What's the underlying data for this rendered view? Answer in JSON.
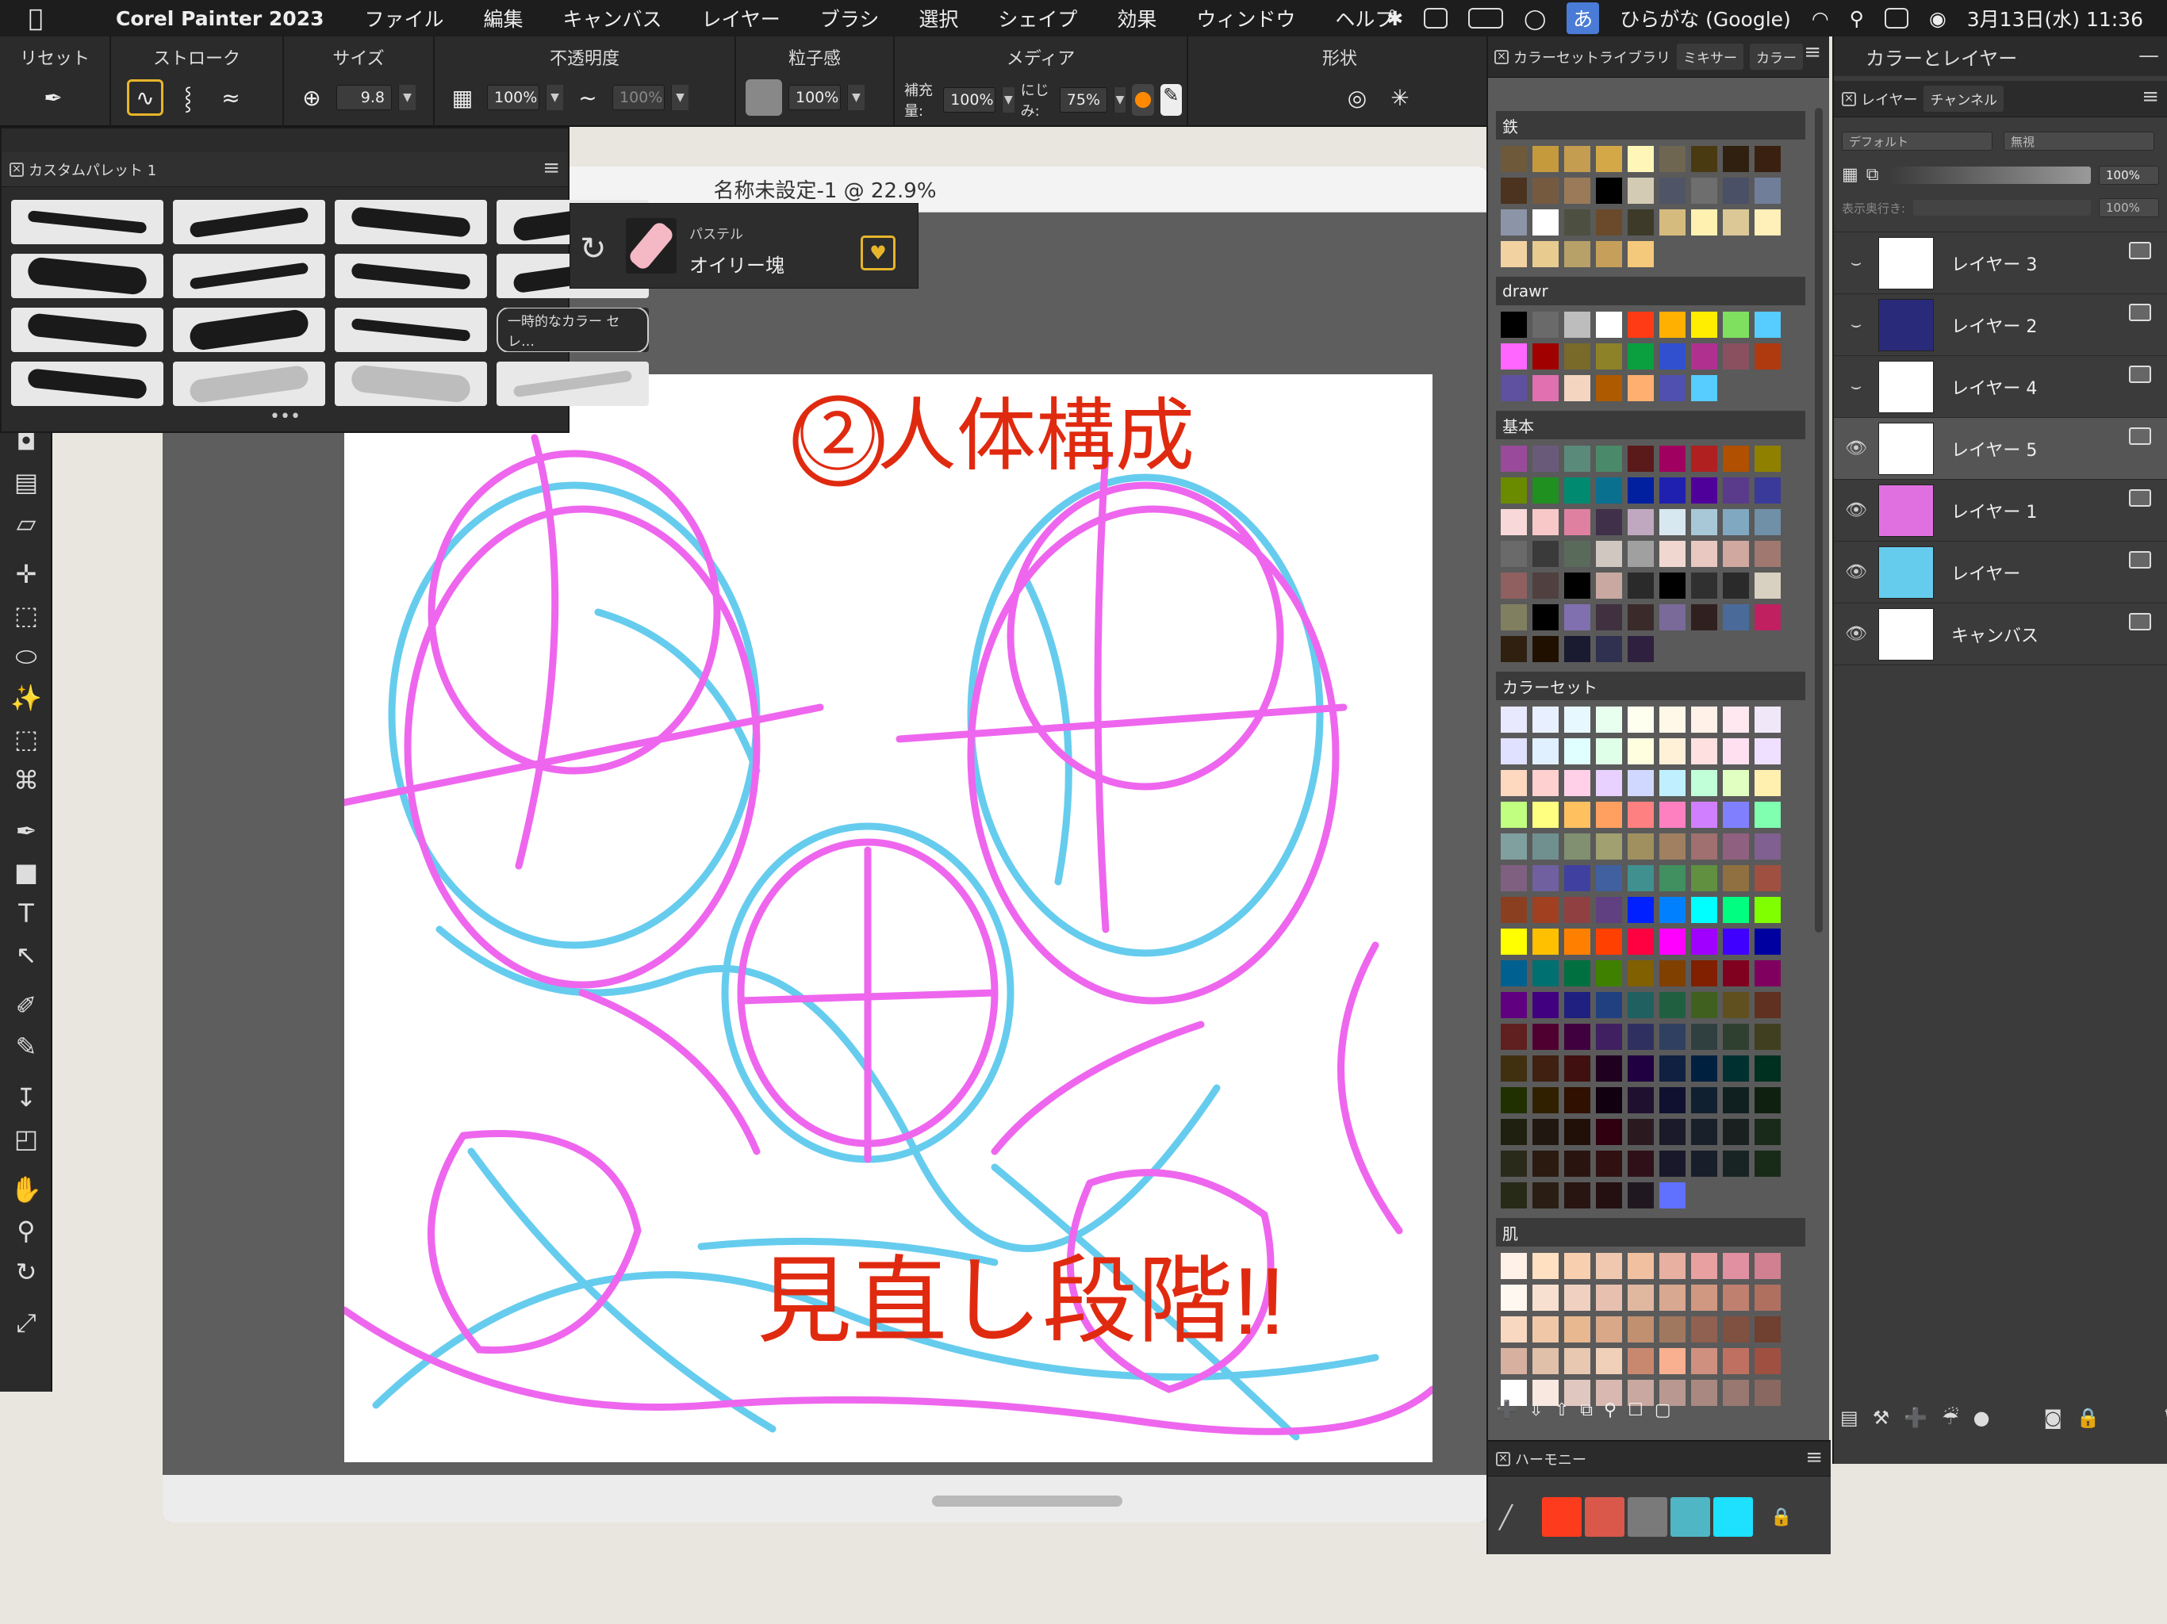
{
  "menubar": {
    "app_name": "Corel Painter 2023",
    "items": [
      "ファイル",
      "編集",
      "キャンバス",
      "レイヤー",
      "ブラシ",
      "選択",
      "シェイプ",
      "効果",
      "ウィンドウ",
      "ヘルプ"
    ],
    "input_method": "ひらがな (Google)",
    "ime_glyph": "あ",
    "datetime": "3月13日(水)  11:36"
  },
  "propbar": {
    "groups": [
      {
        "title": "リセット"
      },
      {
        "title": "ストローク"
      },
      {
        "title": "サイズ"
      },
      {
        "title": "不透明度"
      },
      {
        "title": "粒子感"
      },
      {
        "title": "メディア"
      },
      {
        "title": "形状"
      }
    ],
    "size_value": "9.8",
    "opacity_value": "100%",
    "opacity_value2": "100%",
    "grain_value": "100%",
    "media": {
      "resaturation_label": "補充量:",
      "resaturation_value": "100%",
      "bleed_label": "にじみ:",
      "bleed_value": "75%"
    }
  },
  "document": {
    "title": "名称未設定-1 @ 22.9%"
  },
  "canvas_text": {
    "heading": "②人体構成",
    "footer": "見直し段階!!"
  },
  "custom_palette": {
    "title": "カスタムパレット 1",
    "pill_label": "一時的なカラー セレ…"
  },
  "brush_selector": {
    "category": "パステル",
    "variant": "オイリー塊"
  },
  "color_panel": {
    "tabs": [
      "カラーセットライブラリ",
      "ミキサー",
      "カラー"
    ],
    "sets": [
      {
        "name": "鉄",
        "colors": [
          "#6e5a3a",
          "#c49a3d",
          "#c59d50",
          "#d4a846",
          "#fff6b8",
          "#6e6650",
          "#4a3a12",
          "#2f2010",
          "#3a2010",
          "#4b3320",
          "#765a40",
          "#9a7a58",
          "#000000",
          "#d4cbb5",
          "#4f5566",
          "#6e6e6e",
          "#4a5066",
          "#707e9a",
          "#8c94a8",
          "#ffffff",
          "#4d5040",
          "#6a4a2a",
          "#3d3a2a",
          "#d6bb7e",
          "#fff1b0",
          "#dcc897",
          "#ffefb8",
          "#f3d2a2",
          "#e8cc8f",
          "#b8a168",
          "#c6a05a",
          "#f4c97b"
        ]
      },
      {
        "name": "drawr",
        "colors": [
          "#000000",
          "#6a6a6a",
          "#bdbdbd",
          "#ffffff",
          "#ff3b16",
          "#ffb000",
          "#ffee00",
          "#7fe060",
          "#56ccff",
          "#ff66ff",
          "#a00000",
          "#7a6a2a",
          "#8e8228",
          "#0aa040",
          "#3050d0",
          "#b03090",
          "#8a5060",
          "#b03a10",
          "#6050a0",
          "#e070b0",
          "#f4d6c0",
          "#ad5a00",
          "#ffb070",
          "#5050b0",
          "#56ccff"
        ]
      },
      {
        "name": "基本",
        "colors": [
          "#9a4a9a",
          "#6a5a7a",
          "#5a8a7a",
          "#4a8a6a",
          "#5a1a1a",
          "#a00060",
          "#b02020",
          "#b05000",
          "#908000",
          "#6a8a00",
          "#209020",
          "#008a70",
          "#0a7090",
          "#0020a0",
          "#2020b0",
          "#50009a",
          "#5a3a8a",
          "#3a3a9a",
          "#f8d8d8",
          "#f8c8c8",
          "#e080a0",
          "#40304a",
          "#c0a8c0",
          "#d8e8f0",
          "#a8c8d8",
          "#80a8c0",
          "#7090a8",
          "#6a6a6a",
          "#3a3a3a",
          "#5a6a5a",
          "#d0c8c0",
          "#a0a0a0",
          "#f0d8d0",
          "#e8c8c0",
          "#d0a8a0",
          "#a07870",
          "#906060",
          "#504040",
          "#000000",
          "#c8a8a0",
          "#2a2a2a",
          "#000000",
          "#303030",
          "#2a2a2a",
          "#d8d0c0",
          "#808060",
          "#000000",
          "#8070b0",
          "#403040",
          "#3a2a2a",
          "#7a6a9a",
          "#302020",
          "#4a6a9a",
          "#c02060",
          "#302010",
          "#201000",
          "#1a1a30",
          "#303050",
          "#302040"
        ]
      },
      {
        "name": "カラーセット",
        "colors": [
          "#e8e8ff",
          "#e8f0ff",
          "#e8f8ff",
          "#e8fff0",
          "#fffff0",
          "#fff8e8",
          "#fff0e8",
          "#ffe8f0",
          "#f0e8f8",
          "#e0e0ff",
          "#e0f0ff",
          "#e0ffff",
          "#e0ffe8",
          "#ffffe0",
          "#fff0d8",
          "#ffe0e0",
          "#ffe0f0",
          "#f0e0ff",
          "#ffd8c0",
          "#ffd0d0",
          "#ffd0e8",
          "#e8d0ff",
          "#d0d8ff",
          "#c0f0ff",
          "#c0ffd8",
          "#e0ffc0",
          "#fff0b0",
          "#c0ff80",
          "#ffff80",
          "#ffc060",
          "#ffa060",
          "#ff8080",
          "#ff80c0",
          "#d080ff",
          "#8080ff",
          "#80ffb0",
          "#80a0a0",
          "#709090",
          "#809070",
          "#a0a070",
          "#a09060",
          "#a08060",
          "#a07070",
          "#906080",
          "#806090",
          "#806080",
          "#7060a0",
          "#4040a0",
          "#4060a0",
          "#409090",
          "#409060",
          "#609040",
          "#907040",
          "#a05040",
          "#8a4020",
          "#a04020",
          "#904040",
          "#604080",
          "#0020ff",
          "#0080ff",
          "#00ffff",
          "#00ff80",
          "#80ff00",
          "#ffff00",
          "#ffc000",
          "#ff8000",
          "#ff4000",
          "#ff0040",
          "#ff00ff",
          "#a000ff",
          "#4000ff",
          "#0000a0",
          "#006090",
          "#007070",
          "#007040",
          "#408000",
          "#806000",
          "#804000",
          "#802000",
          "#800020",
          "#800060",
          "#600080",
          "#400080",
          "#202080",
          "#204080",
          "#206060",
          "#206040",
          "#406020",
          "#605020",
          "#603020",
          "#602020",
          "#500030",
          "#400040",
          "#402060",
          "#303060",
          "#304060",
          "#304040",
          "#304030",
          "#404020",
          "#403010",
          "#402010",
          "#401010",
          "#200020",
          "#200040",
          "#102040",
          "#002040",
          "#003030",
          "#003020",
          "#203000",
          "#302000",
          "#301000",
          "#100010",
          "#201030",
          "#101030",
          "#102030",
          "#102020",
          "#102010",
          "#202010",
          "#201810",
          "#201008",
          "#300010",
          "#2a1a20",
          "#1a1a2a",
          "#1a202a",
          "#1a2020",
          "#1a2a1a",
          "#2a2a1a",
          "#2a1a10",
          "#2a1410",
          "#301010",
          "#301018",
          "#18182a",
          "#181e2a",
          "#182424",
          "#182a18",
          "#282a18",
          "#2a1e14",
          "#281410",
          "#241010",
          "#201820",
          "#6070ff"
        ]
      },
      {
        "name": "肌",
        "colors": [
          "#fff0e8",
          "#ffe0c0",
          "#f8d0b0",
          "#f0c8b0",
          "#f0c0a0",
          "#e8b0a0",
          "#e8a0a0",
          "#e090a0",
          "#d08090",
          "#fff8f0",
          "#f8e0d0",
          "#f0d0c0",
          "#e8c0b0",
          "#e0b8a0",
          "#d8a890",
          "#d09880",
          "#c08070",
          "#b07060",
          "#f8d8c0",
          "#f0c8a8",
          "#e8b890",
          "#d8a888",
          "#c09070",
          "#a07860",
          "#906050",
          "#805040",
          "#704030",
          "#d8b0a0",
          "#e0c0a8",
          "#e8c8b0",
          "#f0d0b8",
          "#c88870",
          "#f8b090",
          "#d09080",
          "#c07060",
          "#a05040",
          "#ffffff",
          "#f8e8e0",
          "#e0c8c0",
          "#d8b8b0",
          "#c8a8a0",
          "#b89890",
          "#a88880",
          "#987870",
          "#886860"
        ]
      }
    ],
    "footer_icons": [
      "add-swatch-icon",
      "import-icon",
      "export-icon",
      "library-icon",
      "search-icon",
      "new-set-icon",
      "remove-set-icon"
    ],
    "harmony": {
      "title": "ハーモニー",
      "colors": [
        "#ff3b1e",
        "#d9584a",
        "#7a7a7a",
        "#4fb6c6",
        "#1ee0ff"
      ]
    }
  },
  "layers_panel": {
    "title": "カラーとレイヤー",
    "tabs": [
      "レイヤー",
      "チャンネル"
    ],
    "blend_mode": "デフォルト",
    "composite": "無視",
    "opacity": "100%",
    "depth_label": "表示奥行き:",
    "depth_value": "100%",
    "layers": [
      {
        "name": "レイヤー 3",
        "visible": "hidden",
        "selected": false,
        "thumb": "#ffffff"
      },
      {
        "name": "レイヤー 2",
        "visible": "hidden",
        "selected": false,
        "thumb": "#2a2a7a"
      },
      {
        "name": "レイヤー 4",
        "visible": "hidden",
        "selected": false,
        "thumb": "#ffffff"
      },
      {
        "name": "レイヤー 5",
        "visible": "visible",
        "selected": true,
        "thumb": "#ffffff"
      },
      {
        "name": "レイヤー 1",
        "visible": "visible",
        "selected": false,
        "thumb": "#e070e0"
      },
      {
        "name": "レイヤー",
        "visible": "visible",
        "selected": false,
        "thumb": "#66ccee"
      },
      {
        "name": "キャンバス",
        "visible": "visible",
        "selected": false,
        "thumb": "#ffffff"
      }
    ]
  },
  "colors": {
    "accent": "#e7b52a",
    "sketch_pink": "#ee66ee",
    "sketch_blue": "#66ccee",
    "annotation_red": "#e02a10"
  }
}
